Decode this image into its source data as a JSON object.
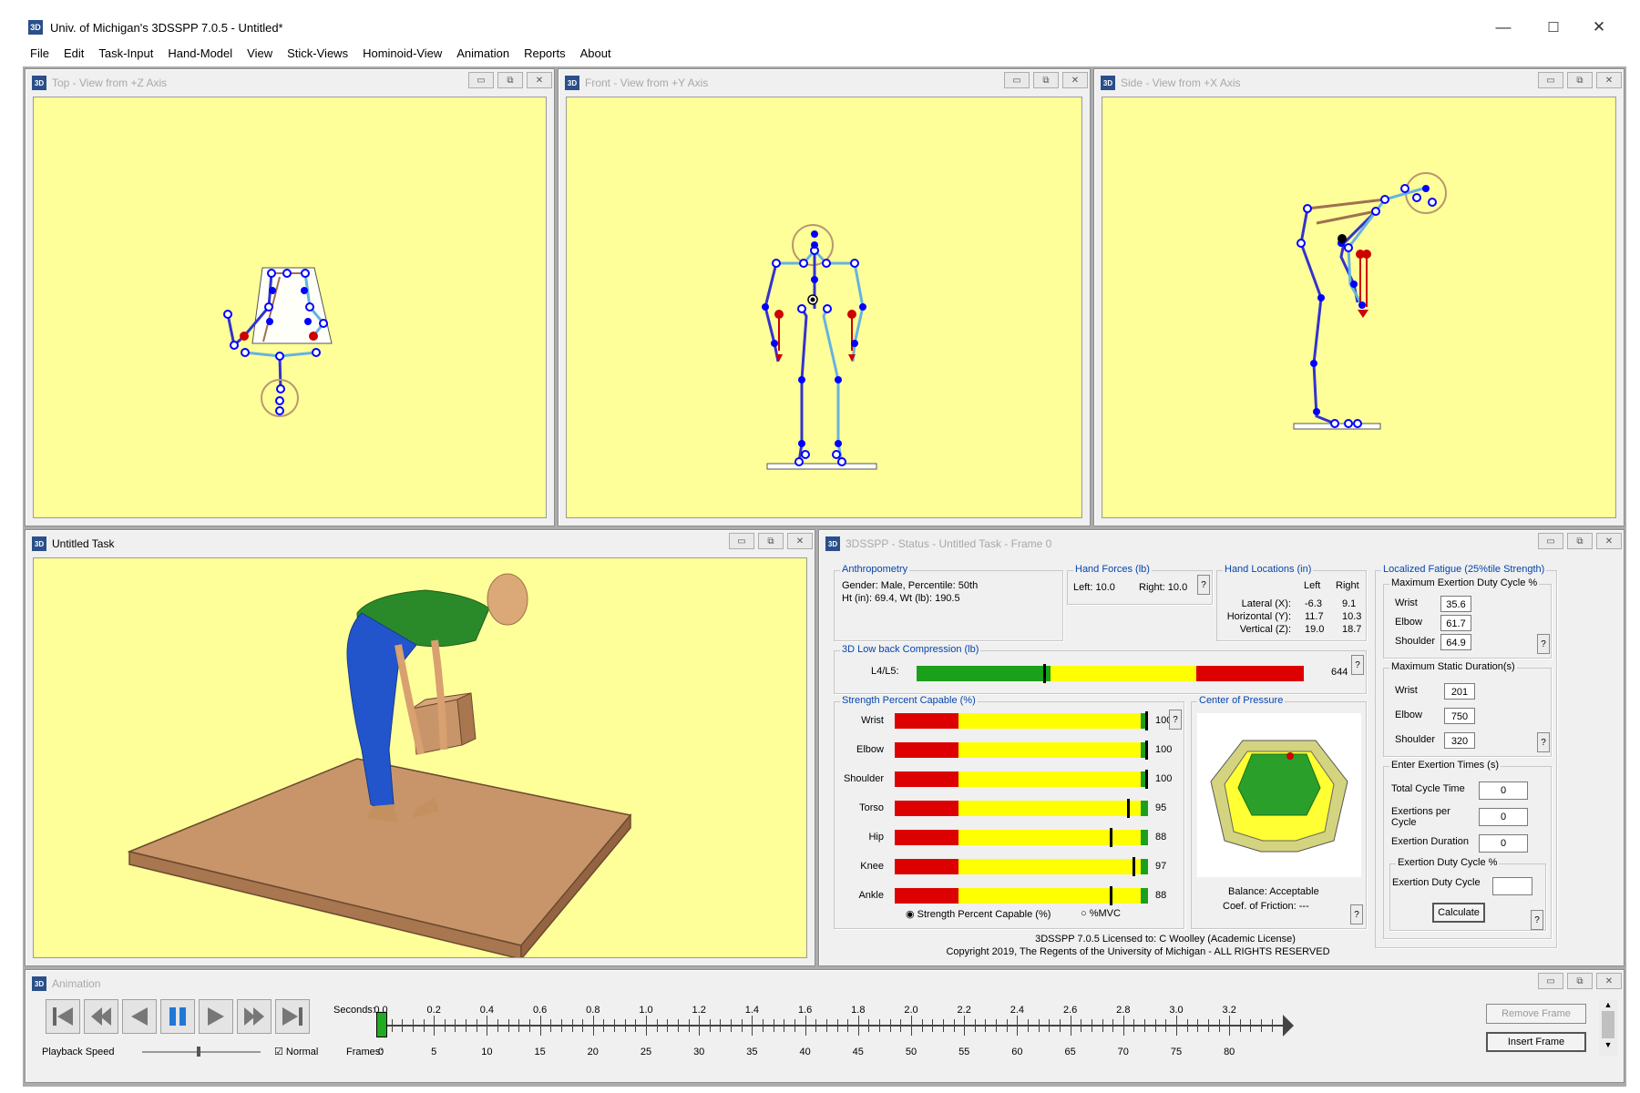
{
  "window": {
    "title": "Univ. of Michigan's 3DSSPP 7.0.5 - Untitled*",
    "app_icon": "3D",
    "minimize": "—",
    "maximize": "☐",
    "close": "✕"
  },
  "menu": [
    "File",
    "Edit",
    "Task-Input",
    "Hand-Model",
    "View",
    "Stick-Views",
    "Hominoid-View",
    "Animation",
    "Reports",
    "About"
  ],
  "views": {
    "top": "Top - View from +Z Axis",
    "front": "Front - View from +Y Axis",
    "side": "Side - View from +X Axis",
    "task": "Untitled Task",
    "status": "3DSSPP - Status - Untitled Task - Frame 0",
    "animation": "Animation"
  },
  "colors": {
    "viewport_bg": "#ffff99",
    "stick_left": "#3333cc",
    "stick_right": "#66b3e0",
    "joint": "#0000ff",
    "hand": "#cc0000",
    "floor": "#c8956a",
    "accent": "#0645ad"
  },
  "status": {
    "anthro": {
      "label": "Anthropometry",
      "line1": "Gender: Male, Percentile: 50th",
      "line2": "Ht (in): 69.4, Wt (lb): 190.5"
    },
    "hand_forces": {
      "label": "Hand Forces (lb)",
      "left": "Left:  10.0",
      "right": "Right:  10.0"
    },
    "hand_locations": {
      "label": "Hand Locations (in)",
      "hdr_left": "Left",
      "hdr_right": "Right",
      "rows": [
        {
          "name": "Lateral (X):",
          "left": "-6.3",
          "right": "9.1"
        },
        {
          "name": "Horizontal (Y):",
          "left": "11.7",
          "right": "10.3"
        },
        {
          "name": "Vertical (Z):",
          "left": "19.0",
          "right": "18.7"
        }
      ]
    },
    "compression": {
      "label": "3D Low back Compression (lb)",
      "row": "L4/L5:",
      "value": "644",
      "fraction": 0.33
    },
    "strength": {
      "label": "Strength Percent Capable (%)",
      "rows": [
        {
          "name": "Wrist",
          "value": "100",
          "pct": 100
        },
        {
          "name": "Elbow",
          "value": "100",
          "pct": 100
        },
        {
          "name": "Shoulder",
          "value": "100",
          "pct": 100
        },
        {
          "name": "Torso",
          "value": "95",
          "pct": 95
        },
        {
          "name": "Hip",
          "value": "88",
          "pct": 88
        },
        {
          "name": "Knee",
          "value": "97",
          "pct": 97
        },
        {
          "name": "Ankle",
          "value": "88",
          "pct": 88
        }
      ],
      "radio1": "Strength Percent Capable (%)",
      "radio2": "%MVC"
    },
    "cop": {
      "label": "Center of Pressure",
      "balance": "Balance: Acceptable",
      "friction": "Coef. of Friction:  ---"
    },
    "fatigue": {
      "label": "Localized Fatigue (25%tile Strength)",
      "duty_label": "Maximum Exertion Duty Cycle %",
      "duty": [
        {
          "name": "Wrist",
          "value": "35.6"
        },
        {
          "name": "Elbow",
          "value": "61.7"
        },
        {
          "name": "Shoulder",
          "value": "64.9"
        }
      ],
      "static_label": "Maximum Static Duration(s)",
      "static": [
        {
          "name": "Wrist",
          "value": "201"
        },
        {
          "name": "Elbow",
          "value": "750"
        },
        {
          "name": "Shoulder",
          "value": "320"
        }
      ],
      "enter_label": "Enter Exertion Times (s)",
      "total_cycle": "Total Cycle Time",
      "total_cycle_val": "0",
      "per_cycle_1": "Exertions per",
      "per_cycle_2": "Cycle",
      "per_cycle_val": "0",
      "duration": "Exertion Duration",
      "duration_val": "0",
      "edc_label": "Exertion Duty Cycle %",
      "edc": "Exertion Duty Cycle",
      "edc_val": "",
      "calculate": "Calculate"
    },
    "license": "3DSSPP 7.0.5 Licensed to: C Woolley (Academic License)",
    "copyright": "Copyright 2019, The Regents of the University of Michigan - ALL RIGHTS RESERVED",
    "q": "?"
  },
  "animation": {
    "seconds_label": "Seconds:",
    "frames_label": "Frames:",
    "seconds": [
      "0.0",
      "0.2",
      "0.4",
      "0.6",
      "0.8",
      "1.0",
      "1.2",
      "1.4",
      "1.6",
      "1.8",
      "2.0",
      "2.2",
      "2.4",
      "2.6",
      "2.8",
      "3.0",
      "3.2"
    ],
    "frames": [
      "0",
      "5",
      "10",
      "15",
      "20",
      "25",
      "30",
      "35",
      "40",
      "45",
      "50",
      "55",
      "60",
      "65",
      "70",
      "75",
      "80"
    ],
    "playback_speed": "Playback Speed",
    "normal": "Normal",
    "remove_frame": "Remove Frame",
    "insert_frame": "Insert Frame"
  }
}
